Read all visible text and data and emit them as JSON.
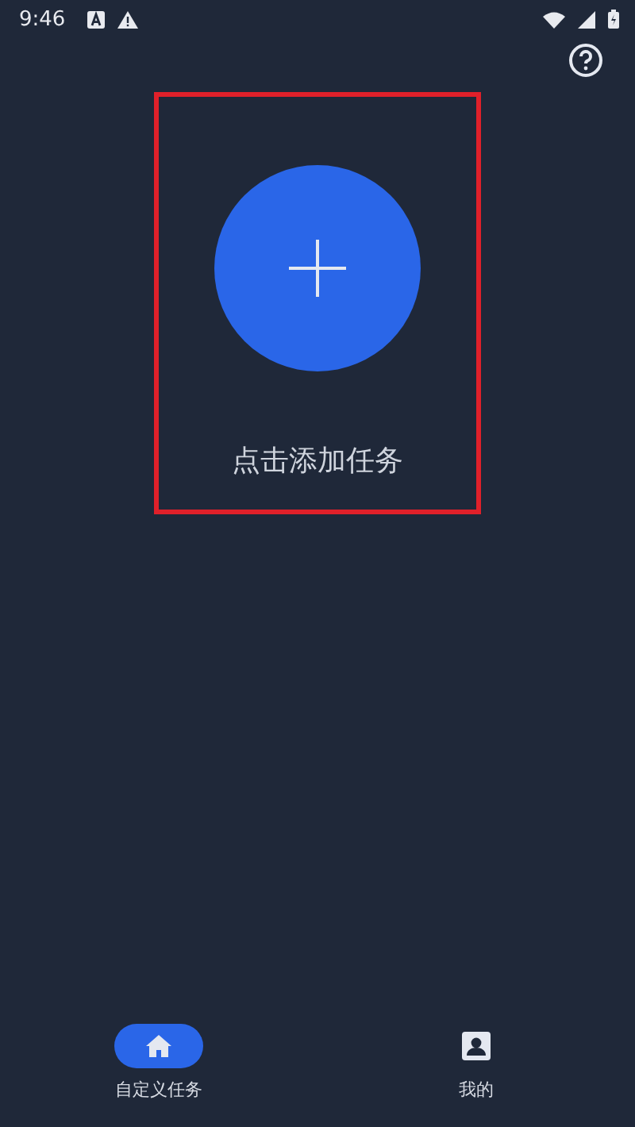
{
  "status_bar": {
    "time": "9:46"
  },
  "add_task": {
    "label": "点击添加任务"
  },
  "bottom_nav": [
    {
      "label": "自定义任务",
      "kind": "home",
      "selected": true
    },
    {
      "label": "我的",
      "kind": "profile",
      "selected": false
    }
  ]
}
